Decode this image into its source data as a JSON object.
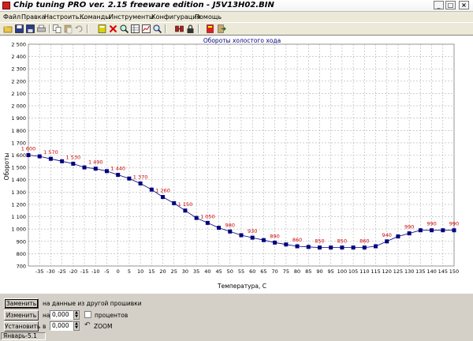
{
  "window": {
    "title": "Chip tuning PRO ver. 2.15 freeware edition  -  J5V13H02.BIN",
    "minimize": "_",
    "maximize": "□",
    "close": "×"
  },
  "menu": [
    "Файл",
    "Правка",
    "Настроить...",
    "Команды",
    "Инструменты",
    "Конфигурация",
    "Помощь"
  ],
  "toolbar_icons": [
    "open-icon",
    "save-icon",
    "save-as-icon",
    "print-icon",
    "copy-icon",
    "paste-icon",
    "undo-icon",
    "calculator-icon",
    "delete-icon",
    "zoom-icon",
    "table-icon",
    "graph-icon",
    "compare-icon",
    "link-icon",
    "lock-icon",
    "book-icon",
    "exit-icon"
  ],
  "chart_data": {
    "type": "line",
    "title": "Обороты холостого хода",
    "xlabel": "Температура, С",
    "ylabel": "Обороты",
    "x": [
      -40,
      -35,
      -30,
      -25,
      -20,
      -15,
      -10,
      -5,
      0,
      5,
      10,
      15,
      20,
      25,
      30,
      35,
      40,
      45,
      50,
      55,
      60,
      65,
      70,
      75,
      80,
      85,
      90,
      95,
      100,
      105,
      110,
      115,
      120,
      125,
      130,
      135,
      140,
      145,
      150
    ],
    "y": [
      1600,
      1590,
      1570,
      1550,
      1530,
      1500,
      1490,
      1470,
      1440,
      1410,
      1370,
      1320,
      1260,
      1210,
      1150,
      1090,
      1050,
      1010,
      980,
      950,
      930,
      910,
      890,
      875,
      860,
      855,
      850,
      850,
      850,
      850,
      850,
      860,
      900,
      940,
      965,
      990,
      990,
      990,
      990
    ],
    "point_labels": [
      {
        "x": -40,
        "text": "1 600"
      },
      {
        "x": -30,
        "text": "1 570"
      },
      {
        "x": -20,
        "text": "1 530"
      },
      {
        "x": -10,
        "text": "1 490"
      },
      {
        "x": 0,
        "text": "1 440"
      },
      {
        "x": 10,
        "text": "1 370"
      },
      {
        "x": 20,
        "text": "1 260"
      },
      {
        "x": 30,
        "text": "1 150"
      },
      {
        "x": 40,
        "text": "1 050"
      },
      {
        "x": 50,
        "text": "980"
      },
      {
        "x": 60,
        "text": "930"
      },
      {
        "x": 70,
        "text": "890"
      },
      {
        "x": 80,
        "text": "860"
      },
      {
        "x": 90,
        "text": "850"
      },
      {
        "x": 100,
        "text": "850"
      },
      {
        "x": 110,
        "text": "860"
      },
      {
        "x": 120,
        "text": "940"
      },
      {
        "x": 130,
        "text": "990"
      },
      {
        "x": 140,
        "text": "990"
      },
      {
        "x": 150,
        "text": "990"
      }
    ],
    "xticks": [
      -35,
      -30,
      -25,
      -20,
      -15,
      -10,
      -5,
      0,
      5,
      10,
      15,
      20,
      25,
      30,
      35,
      40,
      45,
      50,
      55,
      60,
      65,
      70,
      75,
      80,
      85,
      90,
      95,
      100,
      105,
      110,
      115,
      120,
      125,
      130,
      135,
      140,
      145,
      150
    ],
    "yticks": [
      700,
      800,
      900,
      1000,
      1100,
      1200,
      1300,
      1400,
      1500,
      1600,
      1700,
      1800,
      1900,
      2000,
      2100,
      2200,
      2300,
      2400,
      2500
    ],
    "ytick_labels": [
      "700",
      "800",
      "900",
      "1 000",
      "1 100",
      "1 200",
      "1 300",
      "1 400",
      "1 500",
      "1 600",
      "1 700",
      "1 800",
      "1 900",
      "2 000",
      "2 100",
      "2 200",
      "2 300",
      "2 400",
      "2 500"
    ],
    "xlim": [
      -40,
      150
    ],
    "ylim": [
      700,
      2500
    ],
    "grid": true,
    "line_color": "#000080",
    "marker_color": "#000080",
    "label_color": "#cc0000"
  },
  "controls": {
    "replace_button": "Заменить",
    "replace_desc": "на данные из другой прошивки",
    "change_button": "Изменить",
    "change_on": "на",
    "change_value": "0,000",
    "percent_label": "процентов",
    "set_button": "Установить",
    "set_in": "в",
    "set_value": "0,000",
    "zoom_label": "ZOOM"
  },
  "status": "Январь-5.1"
}
